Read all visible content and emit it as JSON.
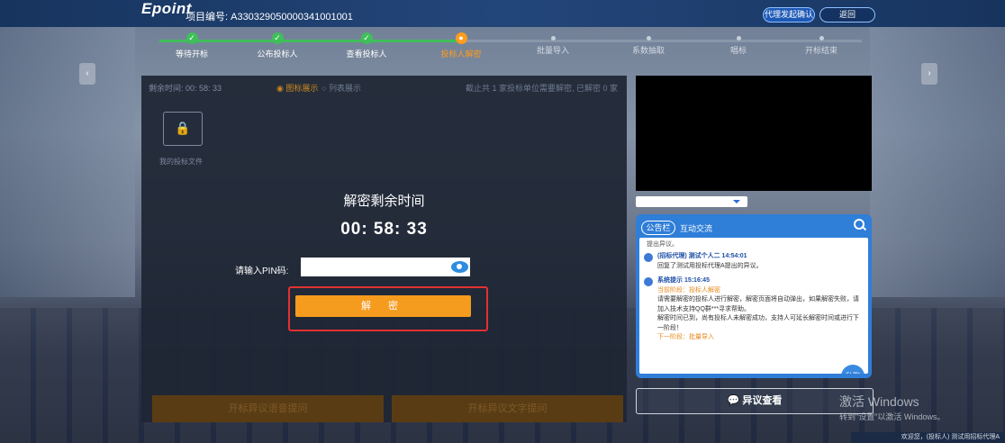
{
  "header": {
    "logo": "Epoint",
    "project_no": "项目编号: A3303290500003410010​01",
    "agent_btn": "代理发起确认",
    "back_btn": "返回"
  },
  "steps": [
    {
      "label": "等待开标",
      "state": "done",
      "icon": "check-icon"
    },
    {
      "label": "公布投标人",
      "state": "done",
      "icon": "check-icon"
    },
    {
      "label": "查看投标人",
      "state": "done",
      "icon": "check-icon"
    },
    {
      "label": "投标人解密",
      "state": "current",
      "icon": "dot-icon"
    },
    {
      "label": "批量导入",
      "state": "todo"
    },
    {
      "label": "系数抽取",
      "state": "todo"
    },
    {
      "label": "唱标",
      "state": "todo"
    },
    {
      "label": "开标结束",
      "state": "todo"
    }
  ],
  "panel": {
    "remaining": "剩余时间: 00: 58: 33",
    "view_icon": "图标展示",
    "view_list": "列表展示",
    "notice": "截止共 1 家投标单位需要解密, 已解密 0 家",
    "folder_label": "我的投标文件",
    "decrypt_title": "解密剩余时间",
    "decrypt_time": "00: 58: 33",
    "pin_label": "请输入PIN码:",
    "pin_value": "",
    "decrypt_btn": "解 密",
    "voice_btn": "开标异议语音提问",
    "text_btn": "开标异议文字提问"
  },
  "board": {
    "tab_announce": "公告栏",
    "tab_chat": "互动交流",
    "top_line": "提出异议。",
    "messages": [
      {
        "head": "(招标代理) 测试个人二 14:54:01",
        "body": "回复了测试用投标代理A提出的异议。"
      },
      {
        "head": "系统提示 15:16:45",
        "stage": "当前阶段：投标人解密",
        "body": "请需要解密的投标人进行解密，解密页面将自动弹出，如果解密失败，请加入技术支持QQ群***寻求帮助。",
        "body2": "解密时间已到，尚有投标人未解密成功，支持人可延长解密时间或进行下一阶段！",
        "next": "下一阶段：批量导入"
      }
    ],
    "private_btn": "私聊"
  },
  "objection_btn": "异议查看",
  "watermark": {
    "line1": "激活 Windows",
    "line2": "转到\"设置\"以激活 Windows。"
  },
  "bottom_status": "欢迎您，(投标人) 测试用招标代理A"
}
